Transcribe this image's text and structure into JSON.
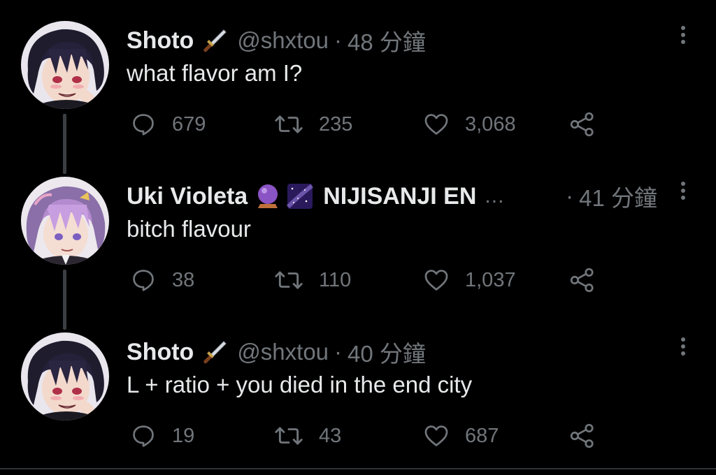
{
  "tweets": [
    {
      "name": "Shoto",
      "name_emoji": "dagger-icon",
      "handle": "@shxtou",
      "separator": "·",
      "time": "48 分鐘",
      "text": "what flavor am I?",
      "replies": "679",
      "retweets": "235",
      "likes": "3,068"
    },
    {
      "name": "Uki Violeta",
      "name_emoji": "crystal-ball-icon",
      "name_emoji_2": "milky-way-icon",
      "name_suffix": "NIJISANJI EN",
      "truncation": "...",
      "separator": "·",
      "time": "41 分鐘",
      "text": "bitch flavour",
      "replies": "38",
      "retweets": "110",
      "likes": "1,037"
    },
    {
      "name": "Shoto",
      "name_emoji": "dagger-icon",
      "handle": "@shxtou",
      "separator": "·",
      "time": "40 分鐘",
      "text": "L + ratio + you died in the end city",
      "replies": "19",
      "retweets": "43",
      "likes": "687"
    }
  ],
  "colors": {
    "background": "#000000",
    "primary_text": "#e7e9ea",
    "secondary_text": "#71767b",
    "thread_line": "#3b3f44"
  }
}
